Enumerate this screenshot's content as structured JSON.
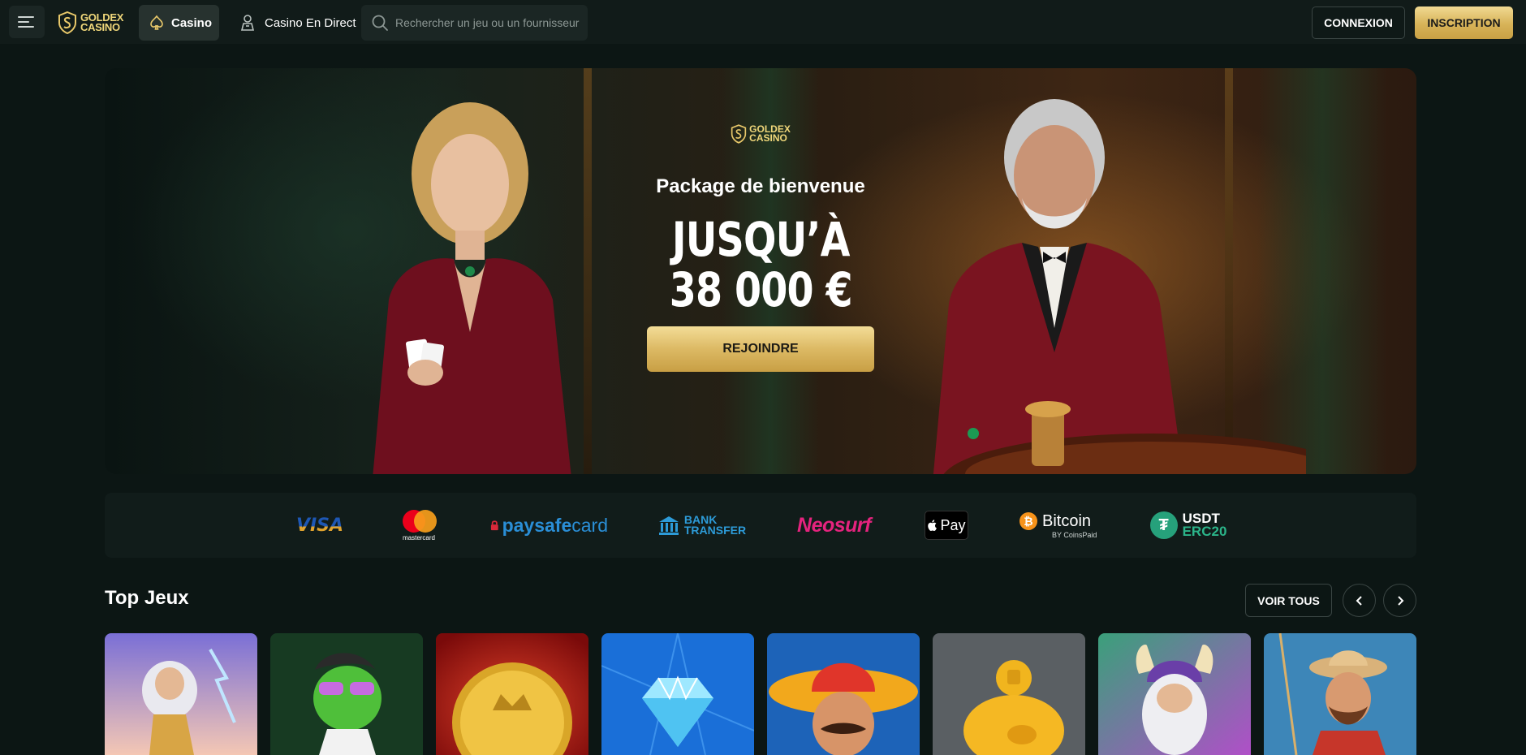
{
  "header": {
    "menu_icon": "hamburger-menu-icon",
    "logo": {
      "line1": "GOLDEX",
      "line2": "CASINO"
    },
    "nav": [
      {
        "label": "Casino",
        "icon": "spade-icon",
        "active": true
      },
      {
        "label": "Casino En Direct",
        "icon": "dealer-icon",
        "active": false
      }
    ],
    "search": {
      "placeholder": "Rechercher un jeu ou un fournisseur",
      "value": ""
    },
    "login_label": "CONNEXION",
    "signup_label": "INSCRIPTION"
  },
  "hero": {
    "logo": {
      "line1": "GOLDEX",
      "line2": "CASINO"
    },
    "subtitle": "Package de bienvenue",
    "title_line1": "JUSQU’À",
    "title_line2": "38 000 €",
    "cta_label": "REJOINDRE"
  },
  "payments": {
    "visa": "VISA",
    "mastercard": "mastercard",
    "paysafecard_bold": "paysafe",
    "paysafecard_thin": "card",
    "bank_line1": "BANK",
    "bank_line2": "TRANSFER",
    "neosurf": "Neosurf",
    "applepay": "Pay",
    "bitcoin": "Bitcoin",
    "bitcoin_by": "BY CoinsPaid",
    "usdt_line1": "USDT",
    "usdt_line2": "ERC20"
  },
  "top_games": {
    "title": "Top Jeux",
    "see_all_label": "VOIR TOUS",
    "prev_icon": "chevron-left-icon",
    "next_icon": "chevron-right-icon"
  },
  "colors": {
    "background": "#0c1614",
    "topbar": "#111b19",
    "gold_accent": "#d7b358",
    "panel": "#111c1a"
  }
}
